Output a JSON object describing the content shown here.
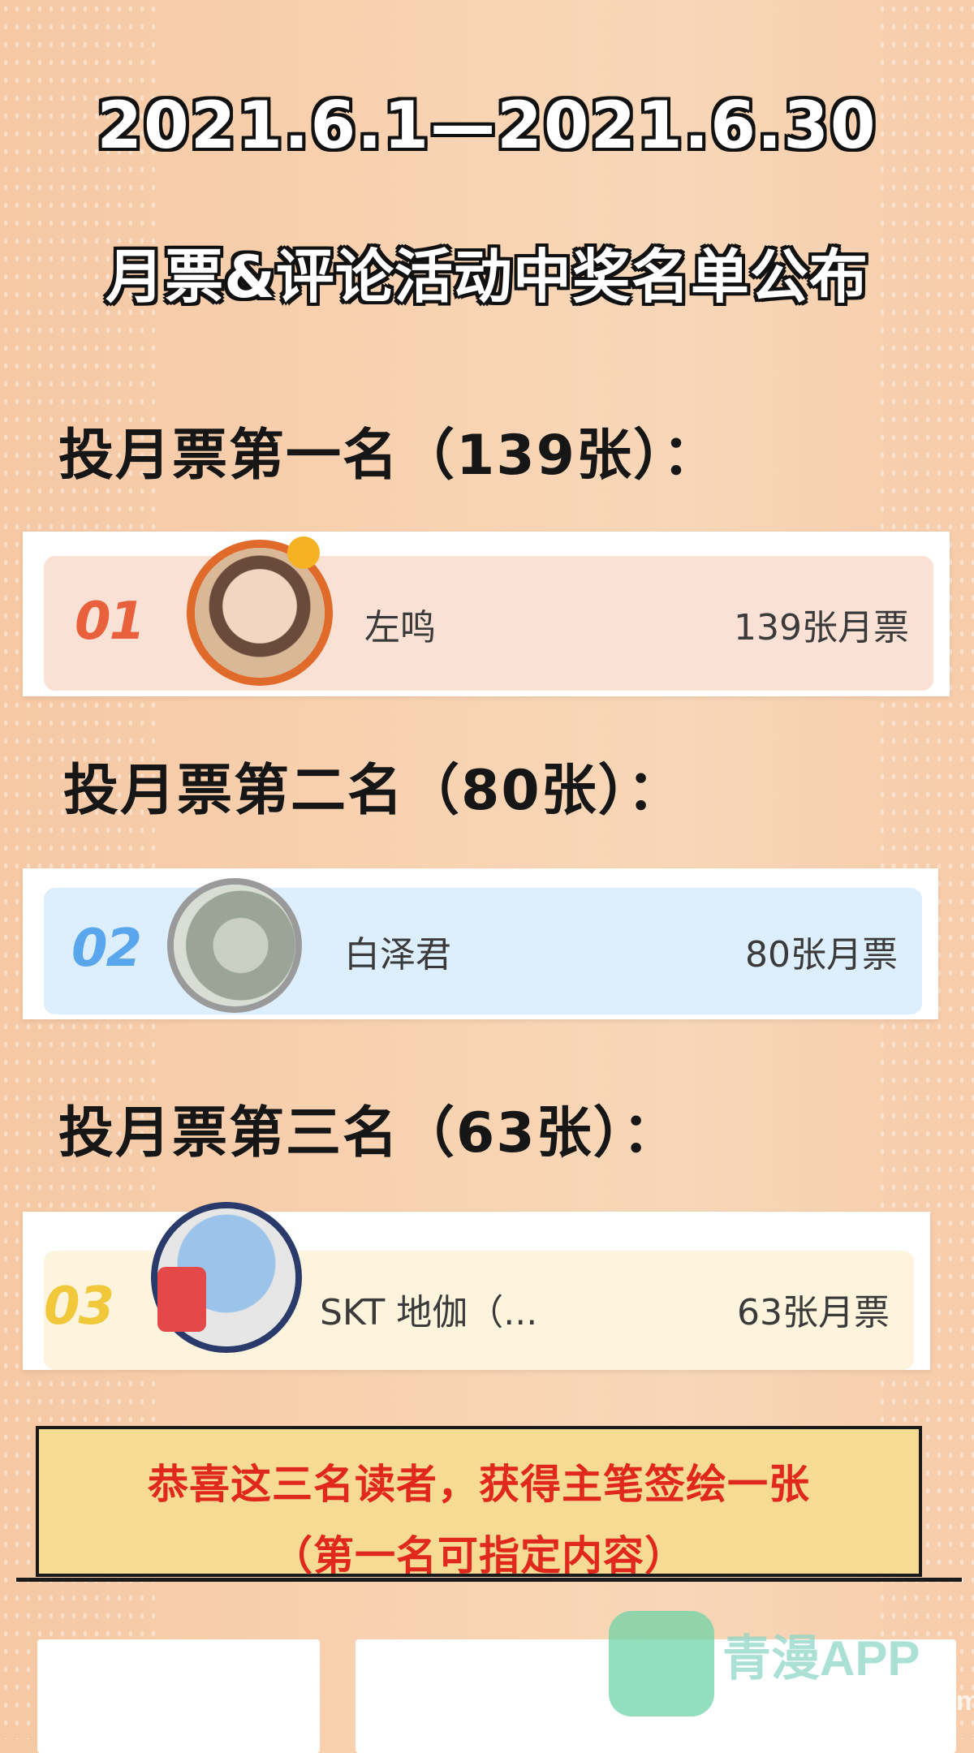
{
  "header": {
    "date_range": "2021.6.1—2021.6.30",
    "title": "月票&评论活动中奖名单公布"
  },
  "rankings": [
    {
      "heading": "投月票第一名（139张）：",
      "rank_label": "01",
      "user": "左鸣",
      "votes": "139张月票",
      "accent": "#e8613c",
      "row_color": "#fae1d6"
    },
    {
      "heading": "投月票第二名（80张）：",
      "rank_label": "02",
      "user": "白泽君",
      "votes": "80张月票",
      "accent": "#5aa6ec",
      "row_color": "#ddeefd"
    },
    {
      "heading": "投月票第三名（63张）：",
      "rank_label": "03",
      "user": "SKT 地伽（...",
      "votes": "63张月票",
      "accent": "#f0c83a",
      "row_color": "#fdf4de"
    }
  ],
  "notice": {
    "line1": "恭喜这三名读者，获得主笔签绘一张",
    "line2": "（第一名可指定内容）"
  },
  "watermark": {
    "brand": "青漫APP",
    "sub": "www.qmanhua.com"
  }
}
